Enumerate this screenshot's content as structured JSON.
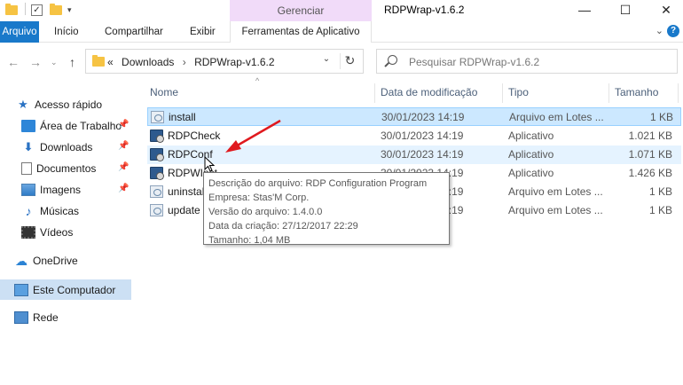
{
  "titlebar": {
    "context_group": "Gerenciar",
    "window_title": "RDPWrap-v1.6.2",
    "minimize": "—",
    "maximize": "☐",
    "close": "✕"
  },
  "ribbon": {
    "tabs": [
      "Arquivo",
      "Início",
      "Compartilhar",
      "Exibir"
    ],
    "context_tab": "Ferramentas de Aplicativo",
    "help": "?",
    "expand": "⌄"
  },
  "address": {
    "overflow": "«",
    "crumbs": [
      "Downloads",
      "RDPWrap-v1.6.2"
    ],
    "separator": "›",
    "dropdown": "⌄",
    "refresh": "↻"
  },
  "search": {
    "placeholder": "Pesquisar RDPWrap-v1.6.2"
  },
  "sidebar": {
    "items": [
      {
        "label": "Acesso rápido",
        "icon": "star-icon",
        "pinned": false
      },
      {
        "label": "Área de Trabalho",
        "icon": "desktop-icon",
        "pinned": true
      },
      {
        "label": "Downloads",
        "icon": "download-icon",
        "pinned": true
      },
      {
        "label": "Documentos",
        "icon": "documents-icon",
        "pinned": true
      },
      {
        "label": "Imagens",
        "icon": "pictures-icon",
        "pinned": true
      },
      {
        "label": "Músicas",
        "icon": "music-icon",
        "pinned": false
      },
      {
        "label": "Vídeos",
        "icon": "videos-icon",
        "pinned": false
      },
      {
        "label": "OneDrive",
        "icon": "cloud-icon",
        "pinned": false
      },
      {
        "label": "Este Computador",
        "icon": "computer-icon",
        "pinned": false
      },
      {
        "label": "Rede",
        "icon": "network-icon",
        "pinned": false
      }
    ]
  },
  "files": {
    "columns": [
      "Nome",
      "Data de modificação",
      "Tipo",
      "Tamanho"
    ],
    "rows": [
      {
        "name": "install",
        "date": "30/01/2023 14:19",
        "type": "Arquivo em Lotes ...",
        "size": "1 KB",
        "icon": "batch-file-icon"
      },
      {
        "name": "RDPCheck",
        "date": "30/01/2023 14:19",
        "type": "Aplicativo",
        "size": "1.021 KB",
        "icon": "application-icon"
      },
      {
        "name": "RDPConf",
        "date": "30/01/2023 14:19",
        "type": "Aplicativo",
        "size": "1.071 KB",
        "icon": "application-icon"
      },
      {
        "name": "RDPWInst",
        "date": "30/01/2023 14:19",
        "type": "Aplicativo",
        "size": "1.426 KB",
        "icon": "application-icon"
      },
      {
        "name": "uninstall",
        "date": "30/01/2023 14:19",
        "type": "Arquivo em Lotes ...",
        "size": "1 KB",
        "icon": "batch-file-icon"
      },
      {
        "name": "update",
        "date": "30/01/2023 14:19",
        "type": "Arquivo em Lotes ...",
        "size": "1 KB",
        "icon": "batch-file-icon"
      }
    ]
  },
  "tooltip": {
    "lines": [
      "Descrição do arquivo: RDP Configuration Program",
      "Empresa: Stas'M Corp.",
      "Versão do arquivo: 1.4.0.0",
      "Data da criação: 27/12/2017 22:29",
      "Tamanho: 1,04 MB"
    ]
  },
  "colors": {
    "accent": "#1979ca",
    "context_tab_bg": "#f1dbf9",
    "selection": "#cce8ff",
    "annotation_arrow": "#e0191e"
  }
}
